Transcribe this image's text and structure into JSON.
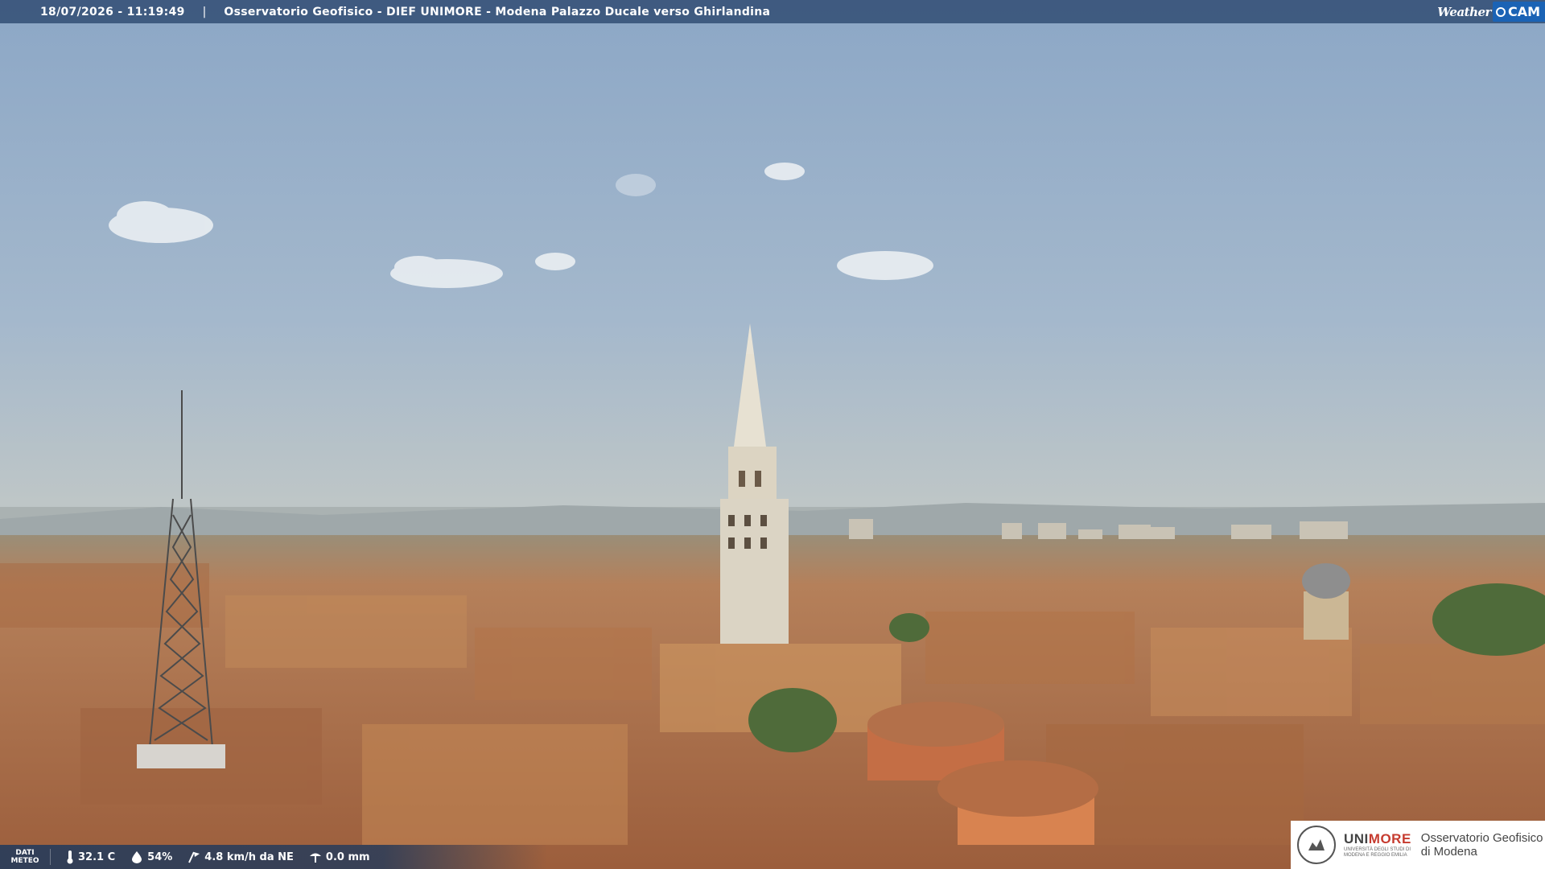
{
  "header": {
    "timestamp": "18/07/2026 - 11:19:49",
    "separator": "|",
    "title": "Osservatorio Geofisico - DIEF UNIMORE - Modena Palazzo Ducale verso Ghirlandina"
  },
  "brand": {
    "weather_text": "Weather",
    "cam_text": "CAM"
  },
  "weather_bar": {
    "label_line1": "DATI",
    "label_line2": "METEO",
    "temperature": "32.1 C",
    "humidity": "54%",
    "wind": "4.8 km/h da NE",
    "rain": "0.0 mm",
    "icons": [
      "thermometer-icon",
      "humidity-icon",
      "wind-icon",
      "rain-gauge-icon"
    ]
  },
  "logo": {
    "unimore_a": "UNI",
    "unimore_b": "MORE",
    "unimore_sub1": "UNIVERSITÀ DEGLI STUDI DI",
    "unimore_sub2": "MODENA E REGGIO EMILIA",
    "observatory_line1": "Osservatorio Geofisico",
    "observatory_line2": "di Modena"
  },
  "colors": {
    "sky_top": "#8fa9c6",
    "sky_horizon": "#b8c4cc",
    "roofs": "#b8744a",
    "bar": "#345076",
    "cam_blue": "#1b63b5",
    "unimore_red": "#c63b2f"
  }
}
